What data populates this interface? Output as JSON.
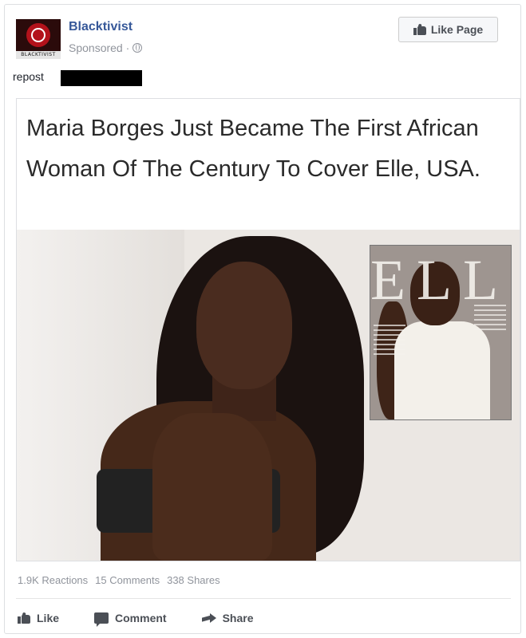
{
  "post": {
    "page_name": "Blacktivist",
    "avatar_text": "BLACKTIVIST",
    "sponsored_label": "Sponsored ·",
    "like_page_label": "Like Page",
    "message": "repost"
  },
  "attachment": {
    "headline": "Maria Borges Just Became The First African Woman Of The Century To Cover Elle, USA."
  },
  "stats": {
    "reactions": "1.9K Reactions",
    "comments": "15 Comments",
    "shares": "338 Shares"
  },
  "actions": {
    "like": "Like",
    "comment": "Comment",
    "share": "Share"
  },
  "colors": {
    "link_blue": "#365899",
    "meta_gray": "#90949c",
    "action_gray": "#4b4f56"
  },
  "icons": [
    "globe-icon",
    "like-thumb-icon",
    "comment-icon",
    "share-icon"
  ]
}
